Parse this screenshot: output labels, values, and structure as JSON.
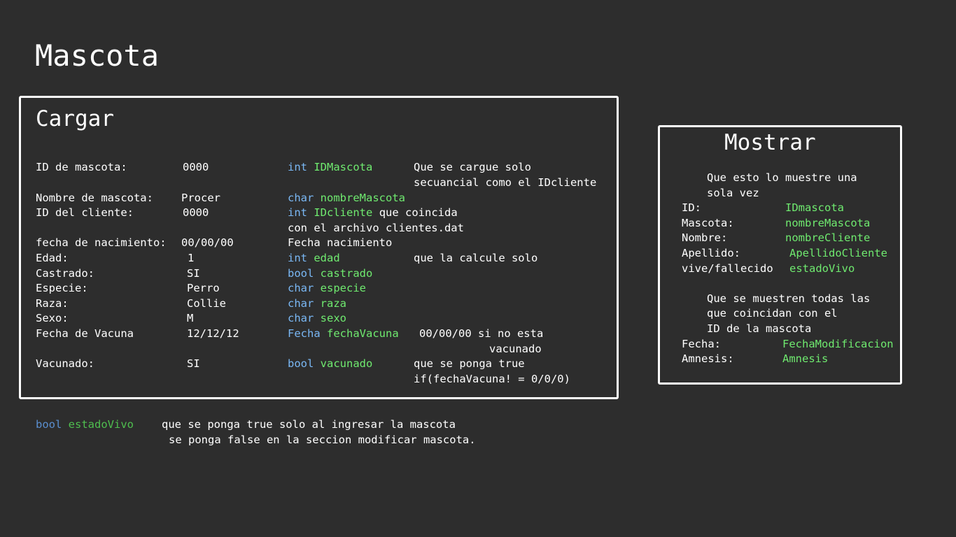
{
  "page_title": "Mascota",
  "cargar": {
    "heading": "Cargar",
    "rows": [
      {
        "label": "ID de mascota:",
        "value": "0000",
        "type": "int",
        "var": "IDMascota",
        "note": "Que se cargue solo"
      },
      {
        "note2": "secuancial como el IDcliente"
      },
      {
        "label": "Nombre de mascota:",
        "value": "Procer",
        "type": "char",
        "var": "nombreMascota"
      },
      {
        "label": "ID del cliente:",
        "value": "0000",
        "type": "int",
        "var": "IDcliente",
        "note": "que coincida"
      },
      {
        "note2": "con el archivo clientes.dat"
      },
      {
        "label": "fecha de nacimiento:",
        "value": "00/00/00",
        "plain": "Fecha nacimiento"
      },
      {
        "label": "Edad:",
        "value": "1",
        "type": "int",
        "var": "edad",
        "note": "que la calcule solo"
      },
      {
        "label": "Castrado:",
        "value": "SI",
        "type": "bool",
        "var": "castrado"
      },
      {
        "label": "Especie:",
        "value": "Perro",
        "type": "char",
        "var": "especie"
      },
      {
        "label": "Raza:",
        "value": "Collie",
        "type": "char",
        "var": "raza"
      },
      {
        "label": "Sexo:",
        "value": "M",
        "type": "char",
        "var": "sexo"
      },
      {
        "label": "Fecha de Vacuna",
        "value": "12/12/12",
        "type": "Fecha",
        "var": "fechaVacuna",
        "note": "00/00/00 si no esta"
      },
      {
        "note2": "vacunado"
      },
      {
        "label": "Vacunado:",
        "value": "SI",
        "type": "bool",
        "var": "vacunado",
        "note": "que se ponga true"
      },
      {
        "note2": "if(fechaVacuna! = 0/0/0)"
      }
    ]
  },
  "mostrar": {
    "heading": "Mostrar",
    "intro1": "Que esto lo muestre una",
    "intro2": "sola vez",
    "fields": [
      {
        "label": "ID:",
        "var": "IDmascota"
      },
      {
        "label": "Mascota:",
        "var": "nombreMascota"
      },
      {
        "label": "Nombre:",
        "var": "nombreCliente"
      },
      {
        "label": "Apellido:",
        "var": "ApellidoCliente"
      },
      {
        "label": "vive/fallecido",
        "var": "estadoVivo"
      }
    ],
    "intro3": "Que se muestren todas las",
    "intro4": "que coincidan con el",
    "intro5": "ID de la mascota",
    "fields2": [
      {
        "label": "Fecha:",
        "var": "FechaModificacion"
      },
      {
        "label": "Amnesis:",
        "var": "Amnesis"
      }
    ]
  },
  "footer": {
    "type": "bool",
    "var": "estadoVivo",
    "line1": "que se ponga true solo al ingresar la mascota",
    "line2": "se ponga false en la seccion modificar mascota."
  }
}
